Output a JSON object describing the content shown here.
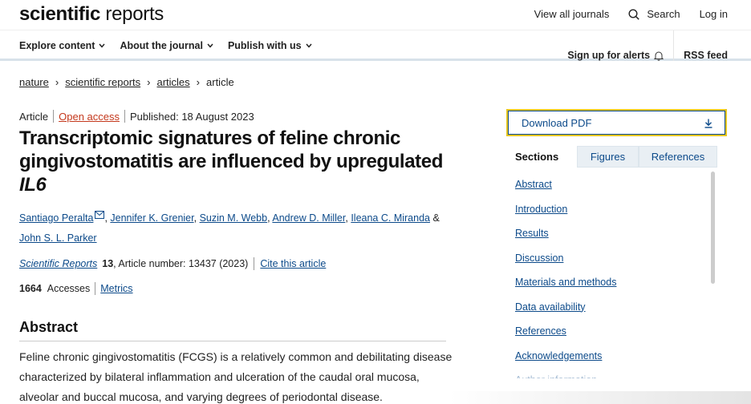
{
  "header": {
    "logo_bold": "scientific",
    "logo_light": " reports",
    "view_all": "View all journals",
    "search": "Search",
    "login": "Log in"
  },
  "nav": {
    "items": [
      "Explore content",
      "About the journal",
      "Publish with us"
    ],
    "alerts": "Sign up for alerts",
    "rss": "RSS feed"
  },
  "breadcrumb": [
    "nature",
    "scientific reports",
    "articles",
    "article"
  ],
  "article": {
    "type": "Article",
    "access": "Open access",
    "published": "Published: 18 August 2023",
    "title_main": "Transcriptomic signatures of feline chronic gingivostomatitis are influenced by upregulated ",
    "title_gene": "IL6",
    "authors": [
      "Santiago Peralta",
      "Jennifer K. Grenier",
      "Suzin M. Webb",
      "Andrew D. Miller",
      "Ileana C. Miranda",
      "John S. L. Parker"
    ],
    "journal": "Scientific Reports",
    "volume": "13",
    "article_number": ", Article number: 13437 (2023)",
    "cite": "Cite this article",
    "accesses_count": "1664",
    "accesses_label": "Accesses",
    "metrics": "Metrics",
    "abstract_heading": "Abstract",
    "abstract_text": "Feline chronic gingivostomatitis (FCGS) is a relatively common and debilitating disease characterized by bilateral inflammation and ulceration of the caudal oral mucosa, alveolar and buccal mucosa, and varying degrees of periodontal disease."
  },
  "sidebar": {
    "download": "Download PDF",
    "tabs": [
      "Sections",
      "Figures",
      "References"
    ],
    "sections": [
      "Abstract",
      "Introduction",
      "Results",
      "Discussion",
      "Materials and methods",
      "Data availability",
      "References",
      "Acknowledgements",
      "Author information"
    ]
  }
}
